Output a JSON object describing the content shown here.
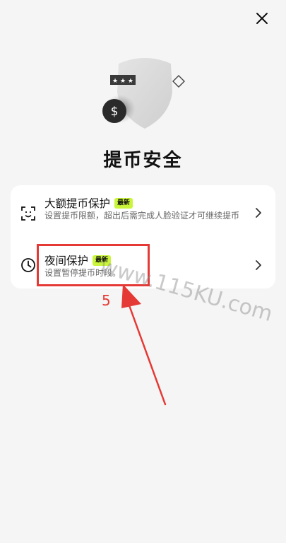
{
  "title": "提币安全",
  "items": [
    {
      "title": "大额提币保护",
      "badge": "最新",
      "description": "设置提币限额，超出后需完成人脸验证才可继续提币"
    },
    {
      "title": "夜间保护",
      "badge": "最新",
      "description": "设置暂停提币时段。"
    }
  ],
  "annotation": {
    "step": "5"
  },
  "watermark": "www.115KU.com",
  "colors": {
    "badge": "#c9f53a",
    "annotation": "#e53935"
  },
  "icons": [
    "close-icon",
    "face-scan-icon",
    "clock-icon",
    "chevron-right-icon",
    "shield-icon",
    "dollar-coin-icon",
    "diamond-icon"
  ]
}
